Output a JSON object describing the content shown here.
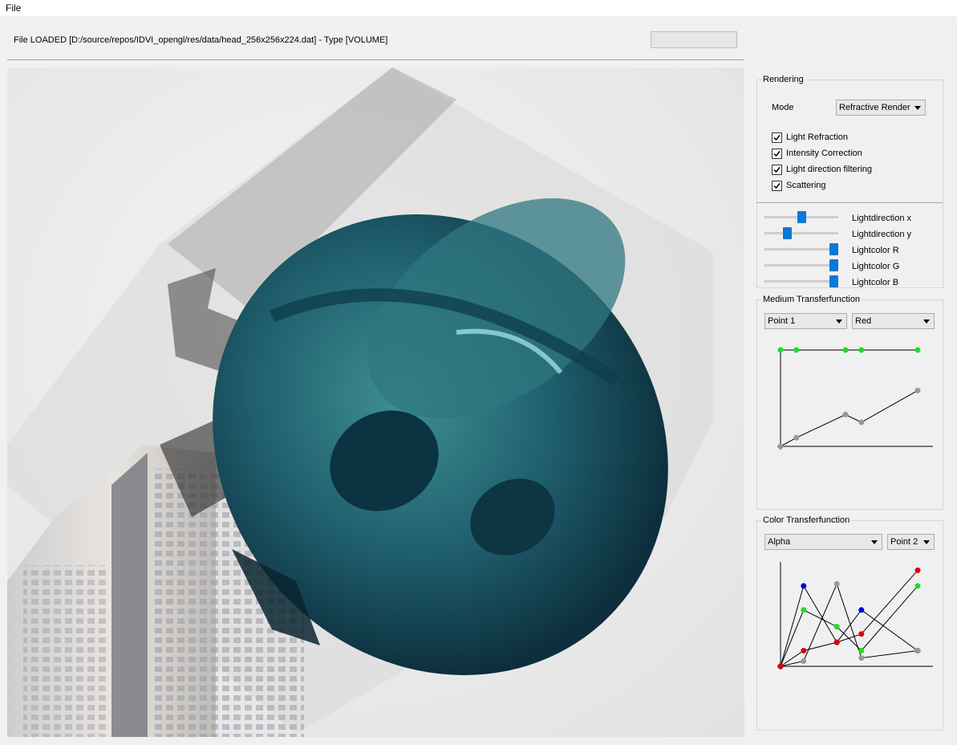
{
  "menu": {
    "file": "File"
  },
  "status": {
    "text": "File LOADED [D:/source/repos/IDVI_opengl/res/data/head_256x256x224.dat] - Type [VOLUME]"
  },
  "rendering": {
    "title": "Rendering",
    "mode_label": "Mode",
    "mode_value": "Refractive Render",
    "checks": [
      {
        "label": "Light Refraction",
        "checked": true
      },
      {
        "label": "Intensity Correction",
        "checked": true
      },
      {
        "label": "Light direction filtering",
        "checked": true
      },
      {
        "label": "Scattering",
        "checked": true
      }
    ],
    "sliders": [
      {
        "label": "Lightdirection x",
        "value": 0.5
      },
      {
        "label": "Lightdirection y",
        "value": 0.28
      },
      {
        "label": "Lightcolor R",
        "value": 1.0
      },
      {
        "label": "Lightcolor G",
        "value": 1.0
      },
      {
        "label": "Lightcolor B",
        "value": 1.0
      }
    ],
    "accent": "#0a78d7"
  },
  "medium_tf": {
    "title": "Medium Transferfunction",
    "point_select": "Point 1",
    "channel_select": "Red",
    "series": [
      {
        "color": "#22dd22",
        "points": [
          [
            0,
            1
          ],
          [
            0.11,
            1
          ],
          [
            0.45,
            1
          ],
          [
            0.56,
            1
          ],
          [
            0.95,
            1
          ]
        ]
      },
      {
        "color": "#999999",
        "points": [
          [
            0,
            0
          ],
          [
            0.11,
            0.09
          ],
          [
            0.45,
            0.33
          ],
          [
            0.56,
            0.25
          ],
          [
            0.95,
            0.58
          ]
        ]
      }
    ]
  },
  "color_tf": {
    "title": "Color Transferfunction",
    "channel_select": "Alpha",
    "point_select": "Point 2",
    "series": [
      {
        "color": "#0000dd",
        "points": [
          [
            0,
            0
          ],
          [
            0.16,
            0.77
          ],
          [
            0.39,
            0.23
          ],
          [
            0.56,
            0.54
          ],
          [
            0.95,
            0.15
          ]
        ]
      },
      {
        "color": "#22dd22",
        "points": [
          [
            0,
            0
          ],
          [
            0.16,
            0.54
          ],
          [
            0.39,
            0.38
          ],
          [
            0.56,
            0.15
          ],
          [
            0.95,
            0.77
          ]
        ]
      },
      {
        "color": "#999999",
        "points": [
          [
            0,
            0
          ],
          [
            0.16,
            0.05
          ],
          [
            0.39,
            0.79
          ],
          [
            0.56,
            0.08
          ],
          [
            0.95,
            0.15
          ]
        ]
      },
      {
        "color": "#dd0000",
        "points": [
          [
            0,
            0
          ],
          [
            0.16,
            0.15
          ],
          [
            0.39,
            0.23
          ],
          [
            0.56,
            0.31
          ],
          [
            0.95,
            0.92
          ]
        ]
      }
    ]
  }
}
